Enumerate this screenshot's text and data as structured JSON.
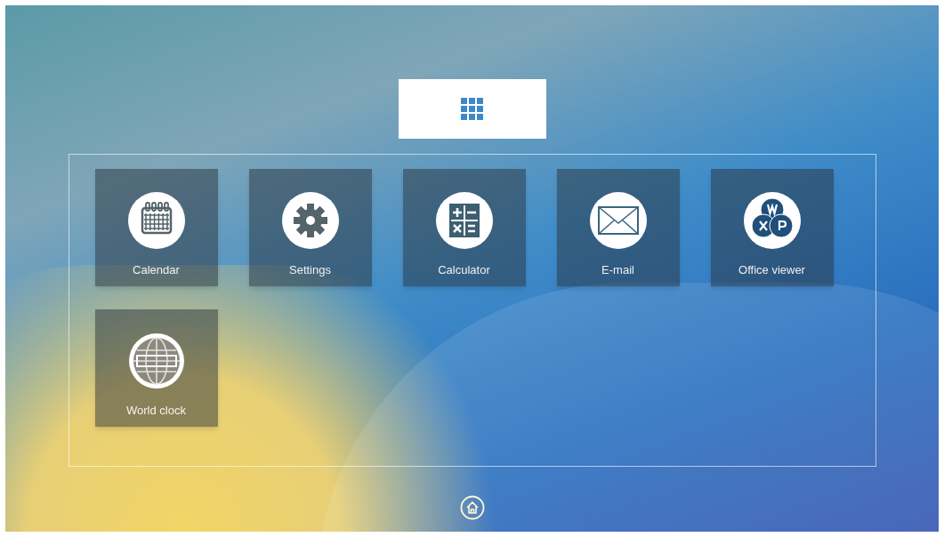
{
  "apps": [
    {
      "label": "Calendar",
      "kind": "calendar"
    },
    {
      "label": "Settings",
      "kind": "settings"
    },
    {
      "label": "Calculator",
      "kind": "calculator"
    },
    {
      "label": "E-mail",
      "kind": "email"
    },
    {
      "label": "Office viewer",
      "kind": "office"
    },
    {
      "label": "World clock",
      "kind": "worldclock"
    }
  ]
}
